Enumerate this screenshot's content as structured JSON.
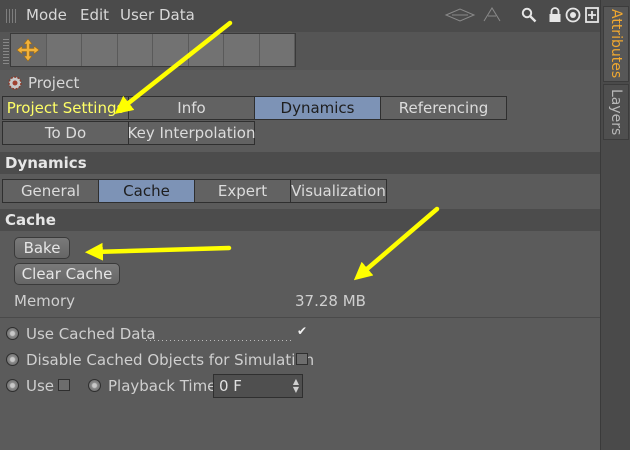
{
  "menu": {
    "mode": "Mode",
    "edit": "Edit",
    "user_data": "User Data"
  },
  "side_tabs": {
    "attributes": "Attributes",
    "layers": "Layers"
  },
  "project": {
    "title": "Project"
  },
  "top_tabs": {
    "row1": [
      "Project Settings",
      "Info",
      "Dynamics",
      "Referencing"
    ],
    "row2": [
      "To Do",
      "Key Interpolation"
    ],
    "selected": "Dynamics"
  },
  "dynamics": {
    "header": "Dynamics",
    "tabs": [
      "General",
      "Cache",
      "Expert",
      "Visualization"
    ],
    "selected": "Cache"
  },
  "cache": {
    "header": "Cache",
    "bake_label": "Bake",
    "clear_label": "Clear Cache",
    "memory_label": "Memory",
    "memory_value": "37.28 MB",
    "use_cached_label": "Use Cached Data",
    "use_cached_checked": true,
    "disable_cached_label": "Disable Cached Objects for Simulation",
    "disable_cached_checked": false,
    "use_label": "Use",
    "use_checked": false,
    "playback_label": "Playback Time",
    "playback_value": "0 F"
  },
  "colors": {
    "selected_tab": "#7d93b6",
    "active_side_tab": "#f0a830",
    "annotation_arrow": "#ffff00"
  },
  "icons": [
    "move-icon",
    "project-gear-icon",
    "search-icon",
    "lock-icon",
    "target-icon",
    "new-panel-icon"
  ]
}
